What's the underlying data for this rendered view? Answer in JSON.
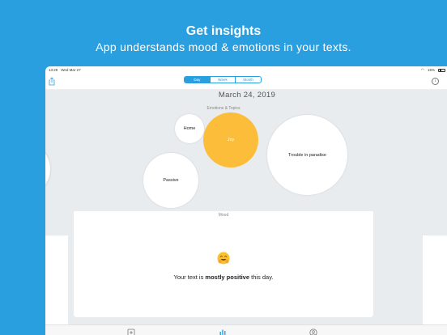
{
  "promo": {
    "title": "Get insights",
    "subtitle": "App understands mood & emotions in your texts."
  },
  "status_bar": {
    "time": "13:29",
    "date": "Wed Mar 27",
    "battery": "15%"
  },
  "segments": [
    {
      "label": "Day",
      "active": true
    },
    {
      "label": "Week",
      "active": false
    },
    {
      "label": "Month",
      "active": false
    }
  ],
  "date": "March 24, 2019",
  "emotions": {
    "title": "Emotions & Topics",
    "bubbles": [
      {
        "label": "Home"
      },
      {
        "label": "Joy"
      },
      {
        "label": "Trouble in paradise"
      },
      {
        "label": "Passive"
      }
    ]
  },
  "mood": {
    "title": "Mood",
    "text_prefix": "Your text is ",
    "text_bold": "mostly positive",
    "text_suffix": " this day."
  },
  "icons": {
    "share": "share-icon",
    "info": "info-icon",
    "compose": "compose-icon",
    "insights": "bar-chart-icon",
    "profile": "profile-icon",
    "emoji": "smiling-face-emoji"
  },
  "colors": {
    "brand": "#2a9fe0",
    "joy": "#fbbd3a",
    "background": "#e8ecef"
  }
}
